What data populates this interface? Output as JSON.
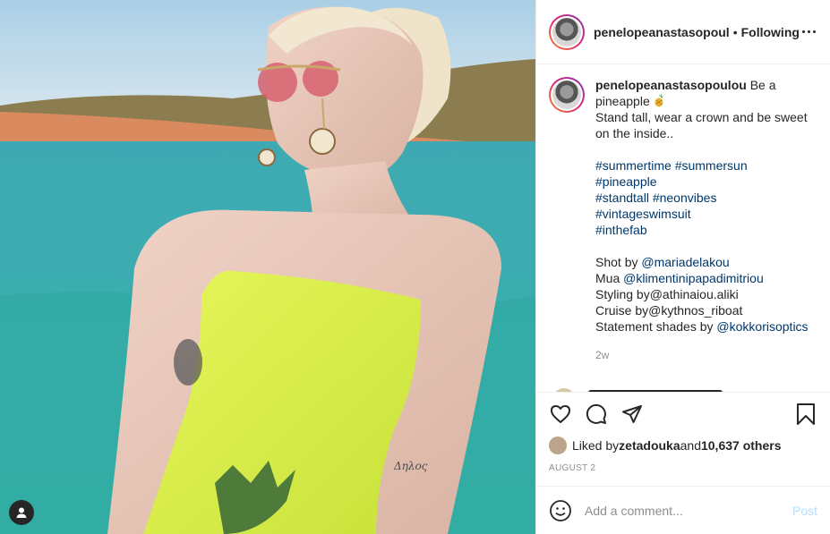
{
  "post": {
    "username": "penelopeanastasopoul",
    "separator": "•",
    "follow_status": "Following"
  },
  "caption": {
    "username": "penelopeanastasopoulou",
    "text1": " Be a",
    "text2": "pineapple ",
    "line2": "Stand tall, wear a crown and be sweet",
    "line3": "on the inside..",
    "hashtags": [
      [
        "#summertime",
        "#summersun"
      ],
      [
        "#pineapple"
      ],
      [
        "#standtall",
        "#neonvibes"
      ],
      [
        "#vintageswimsuit"
      ],
      [
        "#inthefab"
      ]
    ],
    "credits": {
      "shot_prefix": "Shot by ",
      "shot_mention": "@mariadelakou",
      "mua_prefix": "Mua ",
      "mua_mention": "@klimentinipapadimitriou",
      "styling": "Styling by@athinaiou.aliki",
      "cruise": "Cruise by@kythnos_riboat",
      "shades_prefix": "Statement shades by ",
      "shades_mention": "@kokkorisoptics"
    },
    "time": "2w"
  },
  "likes": {
    "prefix": "Liked by ",
    "user": "zetadouka",
    "middle": " and ",
    "count": "10,637 others"
  },
  "date": "AUGUST 2",
  "comment_box": {
    "placeholder": "Add a comment...",
    "post_label": "Post"
  },
  "icons": {
    "like": "heart-icon",
    "comment": "comment-icon",
    "share": "share-icon",
    "save": "bookmark-icon",
    "emoji": "smiley-icon",
    "more": "more-icon",
    "user": "user-tag-icon"
  },
  "colors": {
    "link": "#00376b",
    "muted": "#8e8e8e",
    "post_button": "#b2dffc",
    "swimsuit": "#e4f54a"
  }
}
